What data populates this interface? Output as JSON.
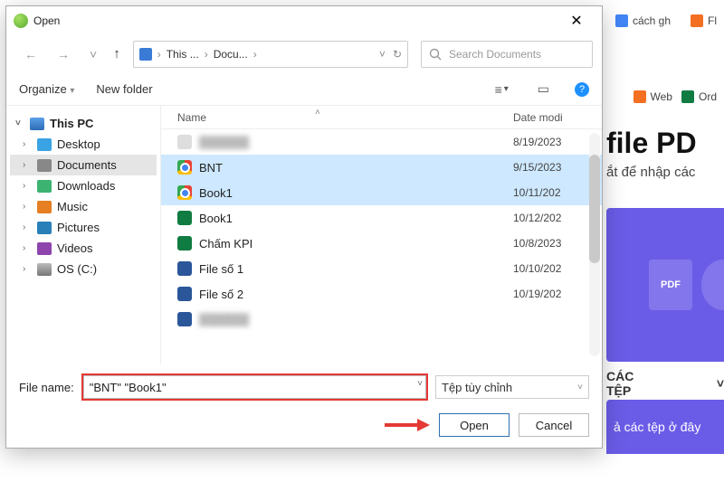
{
  "bg": {
    "tab1": "cách gh",
    "tab2": "Fl",
    "fav1": "Web",
    "fav2": "Ord",
    "headline": "file PD",
    "subhead": "ắt để nhập các",
    "pdf_label": "PDF",
    "accordion": "CÁC TỆP",
    "drop_text": "ả các tệp ở đây"
  },
  "dialog": {
    "title": "Open",
    "close": "✕",
    "nav": {
      "back": "←",
      "fwd": "→",
      "up": "↑",
      "refresh": "↻",
      "dd": "˅"
    },
    "crumb": {
      "a": "This ...",
      "b": "Docu...",
      "sep": "›"
    },
    "search_placeholder": "Search Documents",
    "toolbar": {
      "organize": "Organize",
      "newfolder": "New folder"
    },
    "columns": {
      "name": "Name",
      "date": "Date modi"
    },
    "sidebar": {
      "root": "This PC",
      "items": [
        {
          "label": "Desktop",
          "ico": "ico-desk"
        },
        {
          "label": "Documents",
          "ico": "ico-doc",
          "active": true
        },
        {
          "label": "Downloads",
          "ico": "ico-down"
        },
        {
          "label": "Music",
          "ico": "ico-music"
        },
        {
          "label": "Pictures",
          "ico": "ico-pic"
        },
        {
          "label": "Videos",
          "ico": "ico-vid"
        },
        {
          "label": "OS (C:)",
          "ico": "ico-disk"
        }
      ]
    },
    "files": [
      {
        "name": "",
        "date": "8/19/2023",
        "ico": "",
        "blur": true
      },
      {
        "name": "BNT",
        "date": "9/15/2023",
        "ico": "chrome",
        "sel": true
      },
      {
        "name": "Book1",
        "date": "10/11/202",
        "ico": "chrome",
        "sel": true
      },
      {
        "name": "Book1",
        "date": "10/12/202",
        "ico": "xlsx"
      },
      {
        "name": "Chấm KPI",
        "date": "10/8/2023",
        "ico": "xlsx"
      },
      {
        "name": "File số 1",
        "date": "10/10/202",
        "ico": "doc"
      },
      {
        "name": "File số 2",
        "date": "10/19/202",
        "ico": "doc"
      },
      {
        "name": "",
        "date": "",
        "ico": "doc",
        "blur": true
      }
    ],
    "filename_label": "File name:",
    "filename_value": "\"BNT\" \"Book1\"",
    "filter_label": "Tệp tùy chỉnh",
    "open_btn": "Open",
    "cancel_btn": "Cancel",
    "help": "?"
  }
}
